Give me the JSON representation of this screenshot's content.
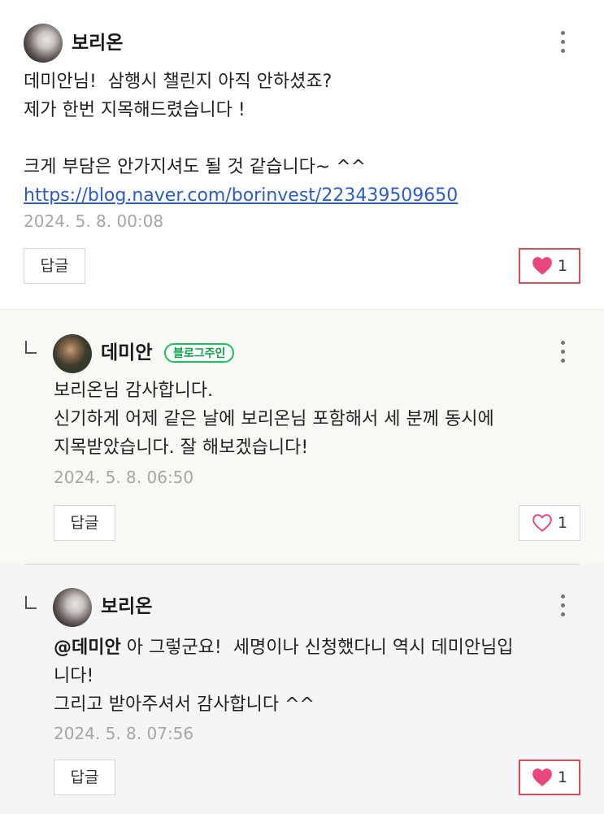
{
  "comments": [
    {
      "author": "보리온",
      "lines": [
        "데미안님!  삼행시 챌린지 아직 안하셨죠?",
        "제가 한번 지목해드렸습니다 !",
        "",
        "크게 부담은 안가지셔도 될 것 같습니다~ ^^"
      ],
      "link": "https://blog.naver.com/borinvest/223439509650",
      "timestamp": "2024. 5. 8. 00:08",
      "reply_label": "답글",
      "like_count": "1",
      "liked": true,
      "avatar_icon": "profile-photo"
    },
    {
      "author": "데미안",
      "badge": "블로그주인",
      "lines": [
        "보리온님 감사합니다.",
        "신기하게 어제 같은 날에 보리온님 포함해서 세 분께 동시에",
        "지목받았습니다. 잘 해보겠습니다!"
      ],
      "timestamp": "2024. 5. 8. 06:50",
      "reply_label": "답글",
      "like_count": "1",
      "liked": false,
      "avatar_icon": "profile-photo"
    },
    {
      "author": "보리온",
      "mention": "@데미안",
      "first_line_rest": " 아 그렇군요!  세명이나 신청했다니 역시 데미안님입",
      "lines": [
        "니다!",
        "그리고 받아주셔서 감사합니다 ^^"
      ],
      "timestamp": "2024. 5. 8. 07:56",
      "reply_label": "답글",
      "like_count": "1",
      "liked": true,
      "avatar_icon": "profile-photo"
    }
  ],
  "colors": {
    "like_active": "#e8467c",
    "like_border": "#e04b5c",
    "badge_green": "#16c45a",
    "link_blue": "#2a5bd7",
    "reply_bg": "#f8f9f4",
    "nested_bg": "#f5f5f5"
  },
  "icons": {
    "more": "more-vertical-icon",
    "heart_filled": "heart-filled-icon",
    "heart_outline": "heart-outline-icon",
    "reply_arrow": "reply-arrow-icon"
  }
}
